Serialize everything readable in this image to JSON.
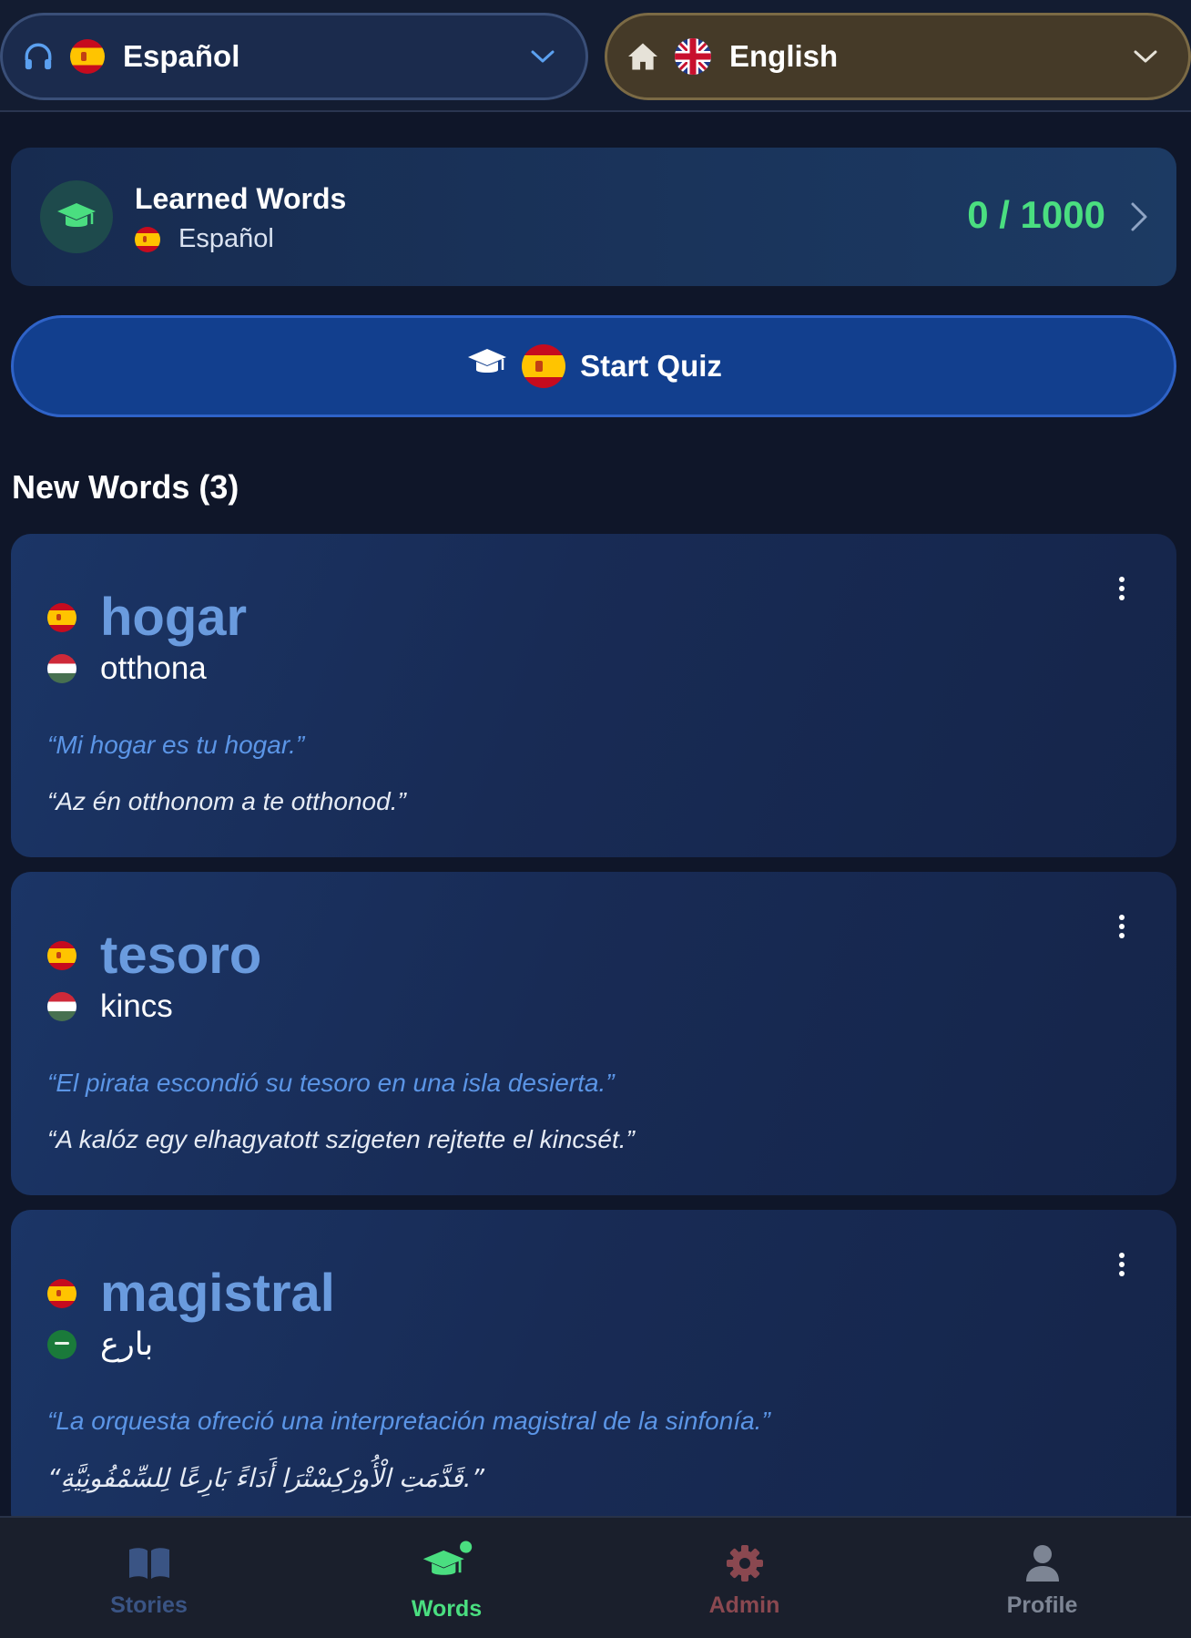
{
  "header": {
    "source_language": {
      "label": "Español",
      "icon": "headphones-icon",
      "flag": "spain"
    },
    "target_language": {
      "label": "English",
      "icon": "home-icon",
      "flag": "united-kingdom"
    }
  },
  "learned": {
    "title": "Learned Words",
    "language": "Español",
    "count": "0 / 1000",
    "progress_fraction": 0
  },
  "quiz": {
    "label": "Start Quiz"
  },
  "section": {
    "title": "New Words (3)"
  },
  "words": [
    {
      "word": "hogar",
      "translation": "otthona",
      "translation_flag": "hungary",
      "example": "“Mi hogar es tu hogar.”",
      "example_translation": "“Az én otthonom a te otthonod.”"
    },
    {
      "word": "tesoro",
      "translation": "kincs",
      "translation_flag": "hungary",
      "example": "“El pirata escondió su tesoro en una isla desierta.”",
      "example_translation": "“A kalóz egy elhagyatott szigeten rejtette el kincsét.”"
    },
    {
      "word": "magistral",
      "translation": "بارع",
      "translation_flag": "saudi-arabia",
      "example": "“La orquesta ofreció una interpretación magistral de la sinfonía.”",
      "example_translation": "“قَدَّمَتِ الْأُورْكِسْتْرَا أَدَاءً بَارِعًا لِلسِّمْفُونِيَّةِ.”"
    }
  ],
  "nav": {
    "stories": "Stories",
    "words": "Words",
    "admin": "Admin",
    "profile": "Profile"
  },
  "colors": {
    "background": "#0f1629",
    "accent_green": "#4ade80",
    "word_blue": "#6a9bde",
    "example_blue": "#5b95e6",
    "quiz_blue": "#123f8e"
  }
}
